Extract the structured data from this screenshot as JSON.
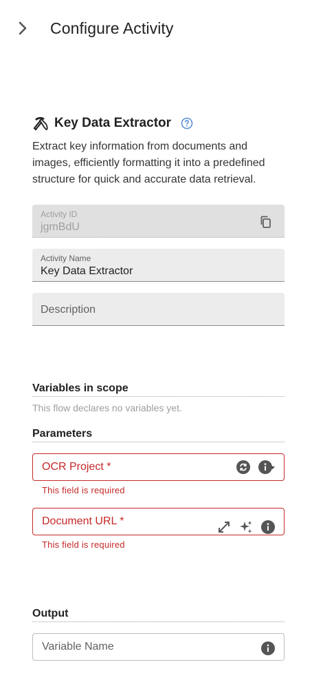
{
  "header": {
    "title": "Configure Activity"
  },
  "activity": {
    "title": "Key Data Extractor",
    "description": "Extract key information from documents and images, efficiently formatting it into a predefined structure for quick and accurate data retrieval."
  },
  "fields": {
    "activity_id": {
      "label": "Activity ID",
      "value": "jgmBdU"
    },
    "activity_name": {
      "label": "Activity Name",
      "value": "Key Data Extractor"
    },
    "description": {
      "placeholder": "Description"
    }
  },
  "variables": {
    "heading": "Variables in scope",
    "empty_text": "This flow declares no variables yet."
  },
  "parameters": {
    "heading": "Parameters",
    "ocr_project": {
      "label": "OCR Project *",
      "error": "This field is required"
    },
    "document_url": {
      "label": "Document URL *",
      "error": "This field is required"
    }
  },
  "output": {
    "heading": "Output",
    "variable_name": {
      "placeholder": "Variable Name"
    }
  },
  "colors": {
    "error": "#c62828",
    "help": "#5b8fd6",
    "icon_dark": "#555555"
  }
}
